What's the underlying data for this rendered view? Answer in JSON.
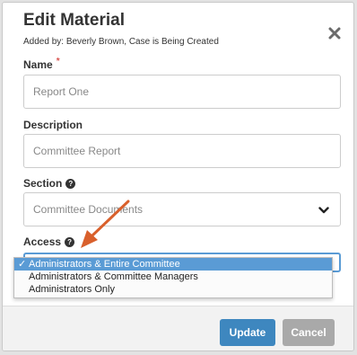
{
  "modal": {
    "title": "Edit Material",
    "subtitle": "Added by: Beverly Brown, Case is Being Created",
    "close_icon": "close-icon"
  },
  "fields": {
    "name": {
      "label": "Name",
      "required_mark": "*",
      "value": "Report One"
    },
    "description": {
      "label": "Description",
      "value": "Committee Report"
    },
    "section": {
      "label": "Section",
      "value": "Committee Documents",
      "help_icon": "help-icon"
    },
    "access": {
      "label": "Access",
      "help_icon": "help-icon",
      "options": [
        {
          "label": "Administrators & Entire Committee",
          "selected": true,
          "check": "✓"
        },
        {
          "label": "Administrators & Committee Managers",
          "selected": false,
          "check": ""
        },
        {
          "label": "Administrators Only",
          "selected": false,
          "check": ""
        }
      ]
    }
  },
  "buttons": {
    "update_label": "Update",
    "cancel_label": "Cancel"
  },
  "colors": {
    "accent": "#3e87bf",
    "selection": "#5a9bd5",
    "required": "#d9534f",
    "annotation_arrow": "#d9602c"
  }
}
